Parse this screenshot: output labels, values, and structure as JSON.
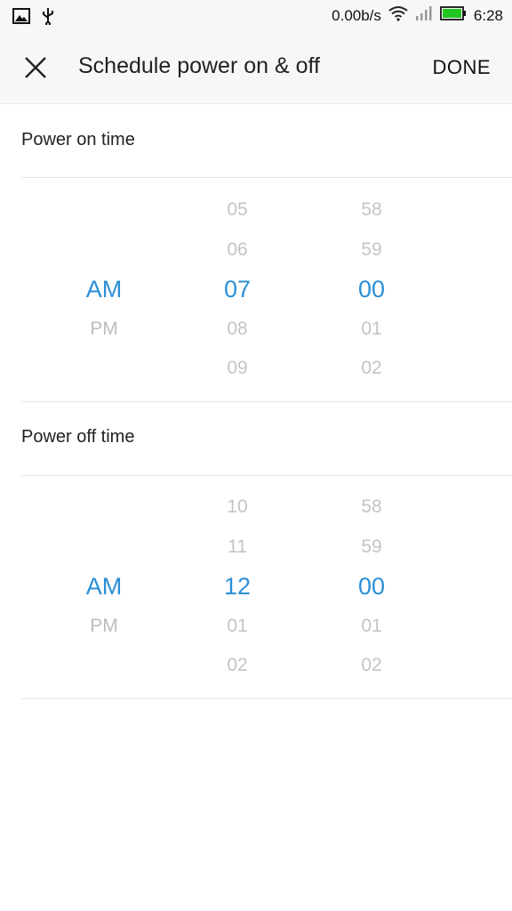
{
  "status_bar": {
    "net_speed": "0.00b/s",
    "time": "6:28",
    "icons": [
      "image-icon",
      "usb-icon",
      "wifi-icon",
      "signal-icon",
      "battery-icon"
    ],
    "battery_color": "#22c622"
  },
  "app_bar": {
    "title": "Schedule power on & off",
    "done_label": "DONE"
  },
  "accent_color": "#2b8fd6",
  "power_on": {
    "label": "Power on time",
    "ampm": {
      "selected": "AM",
      "below": [
        "PM"
      ]
    },
    "hours": {
      "above": [
        "05",
        "06"
      ],
      "selected": "07",
      "below": [
        "08",
        "09"
      ]
    },
    "minutes": {
      "above": [
        "58",
        "59"
      ],
      "selected": "00",
      "below": [
        "01",
        "02"
      ]
    }
  },
  "power_off": {
    "label": "Power off time",
    "ampm": {
      "selected": "AM",
      "below": [
        "PM"
      ]
    },
    "hours": {
      "above": [
        "10",
        "11"
      ],
      "selected": "12",
      "below": [
        "01",
        "02"
      ]
    },
    "minutes": {
      "above": [
        "58",
        "59"
      ],
      "selected": "00",
      "below": [
        "01",
        "02"
      ]
    }
  }
}
